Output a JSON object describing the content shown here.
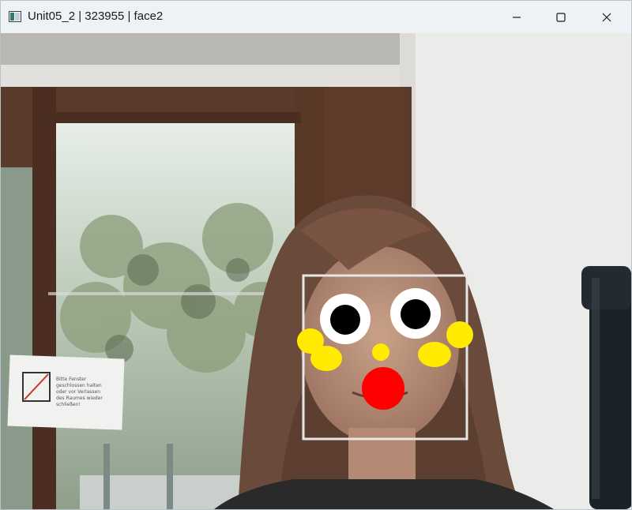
{
  "window": {
    "title": "Unit05_2 | 323955 | face2"
  },
  "controls": {
    "minimize": "minimize-icon",
    "maximize": "maximize-icon",
    "close": "close-icon"
  },
  "camera_scene": {
    "sign_text": "Bitte Fenster geschlossen halten oder vor Verlassen des Raumes wieder schließen!"
  },
  "overlay_colors": {
    "box": "#e6e6e6",
    "eye_white": "#ffffff",
    "pupil": "#000000",
    "cheeks": "#ffea00",
    "nose": "#ff0000"
  }
}
